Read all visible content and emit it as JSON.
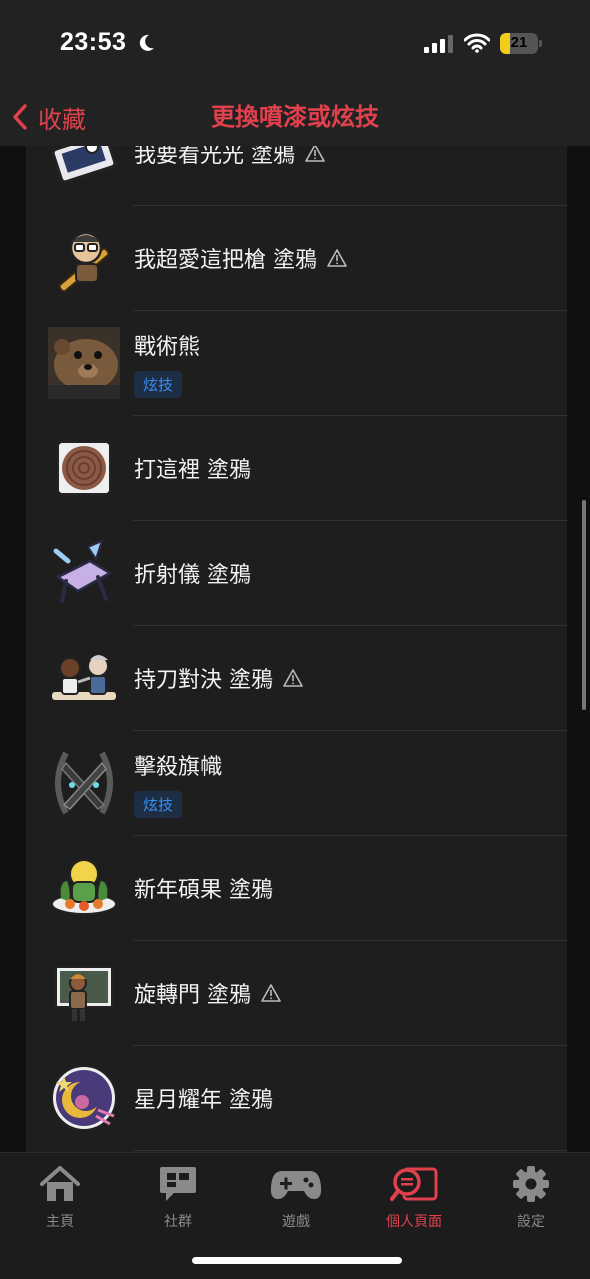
{
  "status": {
    "time": "23:53",
    "battery": "21"
  },
  "nav": {
    "back_label": "收藏",
    "title": "更換噴漆或炫技"
  },
  "colors": {
    "accent": "#e0414d",
    "badge_text": "#3a8ef0"
  },
  "items": [
    {
      "name": "我要看光光 塗鴉",
      "warning": true,
      "badge": ""
    },
    {
      "name": "我超愛這把槍 塗鴉",
      "warning": true,
      "badge": ""
    },
    {
      "name": "戰術熊",
      "warning": false,
      "badge": "炫技"
    },
    {
      "name": "打這裡 塗鴉",
      "warning": false,
      "badge": ""
    },
    {
      "name": "折射儀 塗鴉",
      "warning": false,
      "badge": ""
    },
    {
      "name": "持刀對決 塗鴉",
      "warning": true,
      "badge": ""
    },
    {
      "name": "擊殺旗幟",
      "warning": false,
      "badge": "炫技"
    },
    {
      "name": "新年碩果 塗鴉",
      "warning": false,
      "badge": ""
    },
    {
      "name": "旋轉門 塗鴉",
      "warning": true,
      "badge": ""
    },
    {
      "name": "星月耀年 塗鴉",
      "warning": false,
      "badge": ""
    }
  ],
  "tabs": [
    {
      "label": "主頁",
      "icon": "home-icon"
    },
    {
      "label": "社群",
      "icon": "community-icon"
    },
    {
      "label": "遊戲",
      "icon": "gamepad-icon"
    },
    {
      "label": "個人頁面",
      "icon": "profile-search-icon",
      "active": true
    },
    {
      "label": "設定",
      "icon": "gear-icon"
    }
  ]
}
